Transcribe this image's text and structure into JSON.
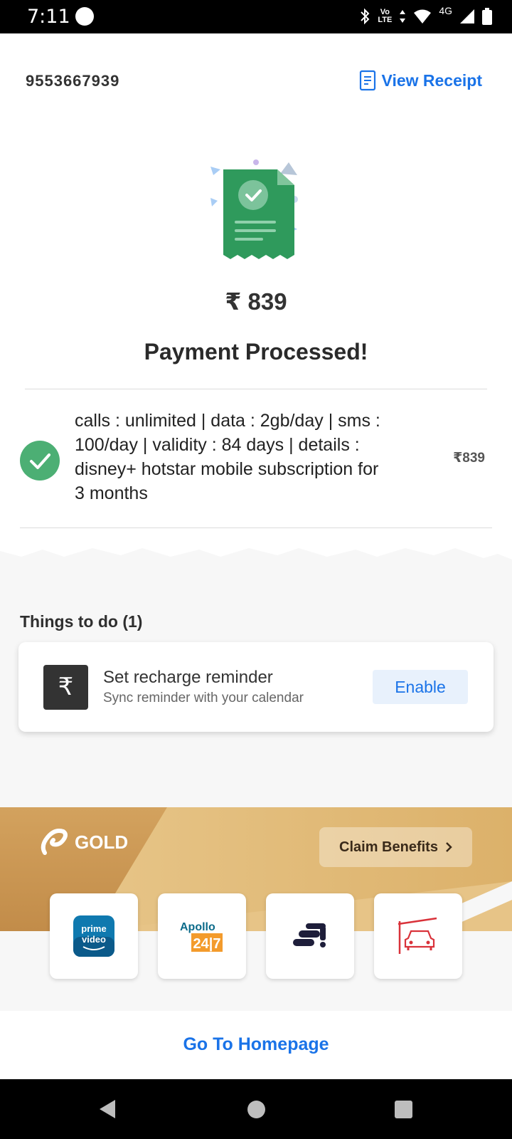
{
  "status_bar": {
    "time": "7:11",
    "network": "4G",
    "volte": "Vo LTE"
  },
  "header": {
    "phone_number": "9553667939",
    "view_receipt_label": "View Receipt"
  },
  "payment": {
    "amount": "₹ 839",
    "status": "Payment Processed!"
  },
  "plan": {
    "description": "calls : unlimited | data : 2gb/day | sms : 100/day | validity : 84 days | details : disney+ hotstar mobile subscription for 3 months",
    "price": "₹839"
  },
  "todo": {
    "title": "Things to do (1)",
    "items": [
      {
        "icon": "rupee-icon",
        "title": "Set recharge reminder",
        "subtitle": "Sync reminder with your calendar",
        "action": "Enable"
      }
    ]
  },
  "gold": {
    "logo_text": "GOLD",
    "claim_label": "Claim Benefits",
    "tiles": [
      {
        "name": "prime video",
        "icon": "prime-video-icon"
      },
      {
        "name": "Apollo 24|7",
        "icon": "apollo-icon"
      },
      {
        "name": "shaw academy",
        "icon": "learning-icon"
      },
      {
        "name": "car parking",
        "icon": "car-icon"
      }
    ]
  },
  "footer": {
    "home_label": "Go To Homepage"
  },
  "colors": {
    "accent": "#1a73e8",
    "success": "#4caf74",
    "gold": "#e0b66e"
  }
}
